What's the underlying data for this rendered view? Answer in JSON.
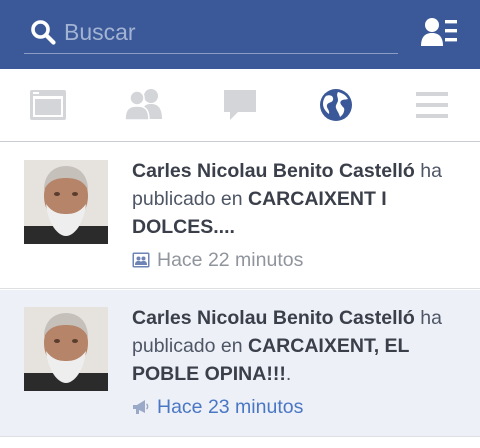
{
  "search": {
    "placeholder": "Buscar"
  },
  "nav": {
    "items": [
      "newsfeed-icon",
      "friend-requests-icon",
      "messages-icon",
      "notifications-globe-icon",
      "menu-icon"
    ],
    "active_color": "#3b5998",
    "inactive_color": "#d3d5d9"
  },
  "notifications": [
    {
      "actor": "Carles Nicolau Benito Castelló",
      "verb": " ha publicado en ",
      "target": "CARCAIXENT I DOLCES....",
      "trailing": "",
      "time": "Hace 22 minutos",
      "icon": "group-icon",
      "unread": false
    },
    {
      "actor": "Carles Nicolau Benito Castelló",
      "verb": " ha publicado en ",
      "target": "CARCAIXENT, EL POBLE OPINA!!!",
      "trailing": ".",
      "time": "Hace 23 minutos",
      "icon": "megaphone-icon",
      "unread": true
    }
  ],
  "colors": {
    "header_blue": "#3b5998",
    "unread_bg": "#edf0f7",
    "time_blue": "#4a77c4",
    "time_gray": "#90949c"
  }
}
